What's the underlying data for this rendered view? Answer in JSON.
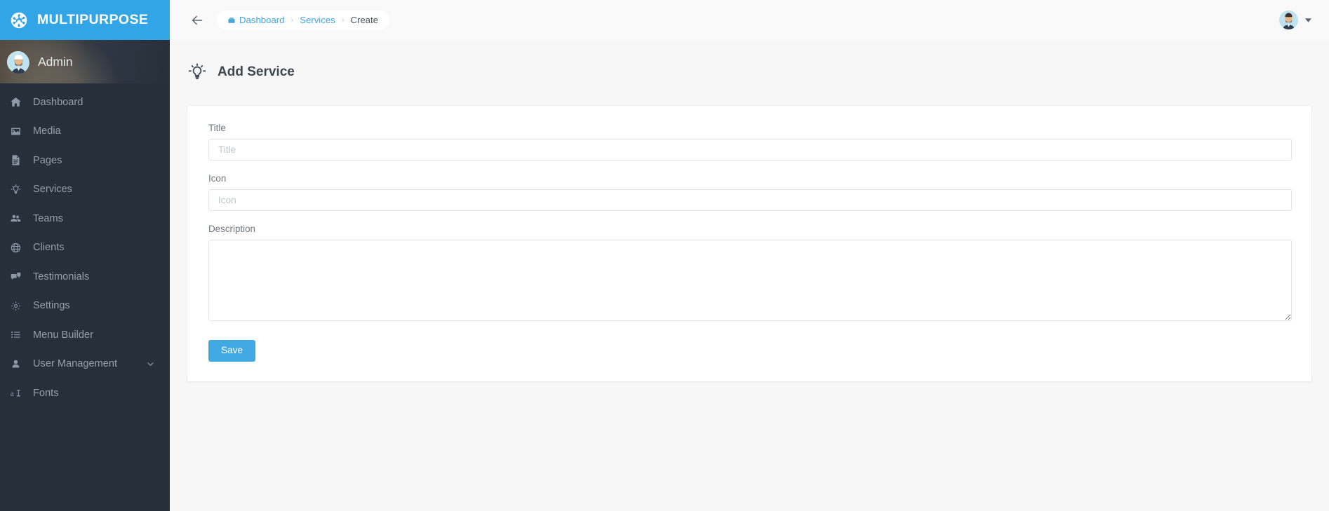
{
  "brand": {
    "name": "MULTIPURPOSE",
    "logo_icon": "ship-wheel-icon",
    "accent_color": "#32a5e7"
  },
  "sidebar": {
    "profile": {
      "name": "Admin",
      "avatar_icon": "user-avatar"
    },
    "items": [
      {
        "label": "Dashboard",
        "icon": "home-icon",
        "has_submenu": false
      },
      {
        "label": "Media",
        "icon": "image-icon",
        "has_submenu": false
      },
      {
        "label": "Pages",
        "icon": "file-text-icon",
        "has_submenu": false
      },
      {
        "label": "Services",
        "icon": "lightbulb-icon",
        "has_submenu": false
      },
      {
        "label": "Teams",
        "icon": "users-icon",
        "has_submenu": false
      },
      {
        "label": "Clients",
        "icon": "globe-icon",
        "has_submenu": false
      },
      {
        "label": "Testimonials",
        "icon": "comments-icon",
        "has_submenu": false
      },
      {
        "label": "Settings",
        "icon": "gear-icon",
        "has_submenu": false
      },
      {
        "label": "Menu Builder",
        "icon": "list-icon",
        "has_submenu": false
      },
      {
        "label": "User Management",
        "icon": "user-icon",
        "has_submenu": true
      },
      {
        "label": "Fonts",
        "icon": "font-icon",
        "has_submenu": false
      }
    ]
  },
  "topbar": {
    "back_icon": "arrow-left-icon",
    "breadcrumb": [
      {
        "label": "Dashboard",
        "icon": "dashboard-icon",
        "current": false
      },
      {
        "label": "Services",
        "icon": "",
        "current": false
      },
      {
        "label": "Create",
        "icon": "",
        "current": true
      }
    ],
    "separator": "›",
    "user_menu": {
      "avatar_icon": "user-avatar",
      "caret_icon": "caret-down-icon"
    }
  },
  "page": {
    "title": "Add Service",
    "title_icon": "lightbulb-icon"
  },
  "form": {
    "fields": [
      {
        "name": "title",
        "label": "Title",
        "placeholder": "Title",
        "value": "",
        "type": "text"
      },
      {
        "name": "icon",
        "label": "Icon",
        "placeholder": "Icon",
        "value": "",
        "type": "text"
      },
      {
        "name": "description",
        "label": "Description",
        "placeholder": "",
        "value": "",
        "type": "textarea"
      }
    ],
    "save_label": "Save",
    "save_color": "#41aae4"
  }
}
